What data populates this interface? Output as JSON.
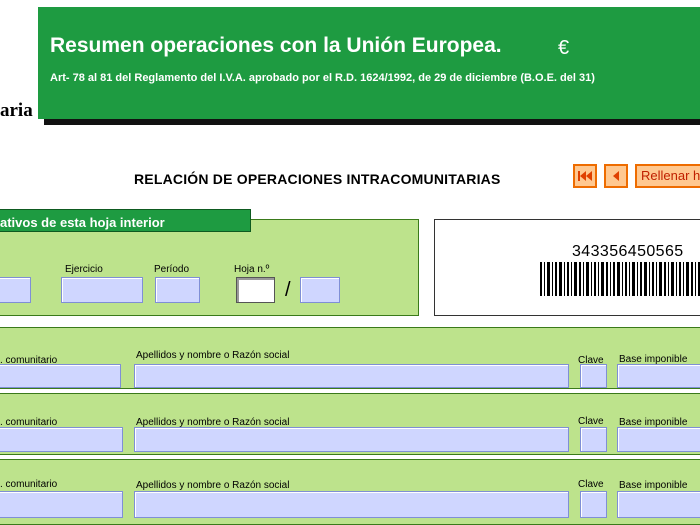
{
  "header": {
    "logo_text": "aria",
    "title": "Resumen operaciones con la Unión Europea.",
    "currency_icon": "€",
    "subtitle": "Art- 78 al 81 del Reglamento del I.V.A. aprobado por el R.D. 1624/1992, de 29 de diciembre (B.O.E. del 31)"
  },
  "relation": {
    "title": "RELACIÓN DE OPERACIONES INTRACOMUNITARIAS",
    "first_icon": "first-page",
    "prev_icon": "previous-page",
    "fill_label": "Rellenar h"
  },
  "ident": {
    "section_label": "ativos de esta hoja interior",
    "ejercicio_label": "Ejercicio",
    "periodo_label": "Período",
    "hoja_label": "Hoja n.º",
    "separator": "/"
  },
  "barcode": {
    "number": "343356450565"
  },
  "operations": [
    {
      "nif_label": ". comunitario",
      "name_label": "Apellidos y nombre o Razón social",
      "clave_label": "Clave",
      "base_label": "Base imponible"
    },
    {
      "nif_label": ". comunitario",
      "name_label": "Apellidos y nombre o Razón social",
      "clave_label": "Clave",
      "base_label": "Base imponible"
    },
    {
      "nif_label": ". comunitario",
      "name_label": "Apellidos y nombre o Razón social",
      "clave_label": "Clave",
      "base_label": "Base imponible"
    }
  ],
  "colors": {
    "banner_green": "#1e9b41",
    "panel_green": "#bde38c",
    "field_blue": "#cfd6ff",
    "button_orange": "#ffc890",
    "button_border": "#ee6c00"
  }
}
